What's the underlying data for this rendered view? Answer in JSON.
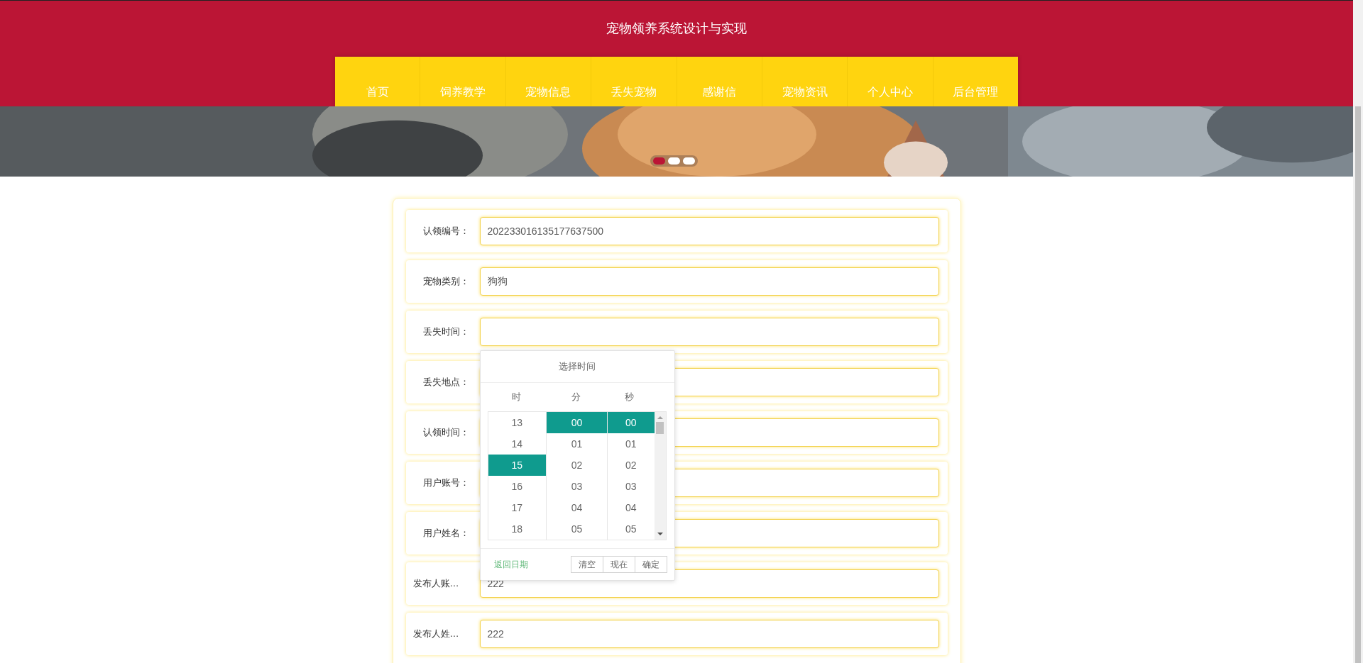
{
  "header": {
    "title": "宠物领养系统设计与实现"
  },
  "nav": [
    {
      "label": "首页"
    },
    {
      "label": "饲养教学"
    },
    {
      "label": "宠物信息"
    },
    {
      "label": "丢失宠物"
    },
    {
      "label": "感谢信"
    },
    {
      "label": "宠物资讯"
    },
    {
      "label": "个人中心"
    },
    {
      "label": "后台管理"
    }
  ],
  "banner": {
    "kind": "picture",
    "dots": [
      {
        "selected": true
      },
      {
        "selected": false
      },
      {
        "selected": false
      }
    ]
  },
  "form": {
    "fields": [
      {
        "label": "认领编号：",
        "value": "202233016135177637500"
      },
      {
        "label": "宠物类别：",
        "value": "狗狗"
      },
      {
        "label": "丢失时间："
      },
      {
        "label": "丢失地点："
      },
      {
        "label": "认领时间："
      },
      {
        "label": "用户账号："
      },
      {
        "label": "用户姓名："
      },
      {
        "label": "发布人账…",
        "value": "222"
      },
      {
        "label": "发布人姓…",
        "value": "222"
      }
    ]
  },
  "time_picker": {
    "title": "选择时间",
    "columns": [
      {
        "header": "时",
        "items": [
          {
            "label": "13",
            "selected": false
          },
          {
            "label": "14",
            "selected": false
          },
          {
            "label": "15",
            "selected": true
          },
          {
            "label": "16",
            "selected": false
          },
          {
            "label": "17",
            "selected": false
          },
          {
            "label": "18",
            "selected": false
          }
        ]
      },
      {
        "header": "分",
        "items": [
          {
            "label": "00",
            "selected": true
          },
          {
            "label": "01",
            "selected": false
          },
          {
            "label": "02",
            "selected": false
          },
          {
            "label": "03",
            "selected": false
          },
          {
            "label": "04",
            "selected": false
          },
          {
            "label": "05",
            "selected": false
          }
        ]
      },
      {
        "header": "秒",
        "items": [
          {
            "label": "00",
            "selected": true
          },
          {
            "label": "01",
            "selected": false
          },
          {
            "label": "02",
            "selected": false
          },
          {
            "label": "03",
            "selected": false
          },
          {
            "label": "04",
            "selected": false
          },
          {
            "label": "05",
            "selected": false
          }
        ]
      }
    ],
    "back_link": "返回日期",
    "buttons": [
      "清空",
      "现在",
      "确定"
    ]
  }
}
